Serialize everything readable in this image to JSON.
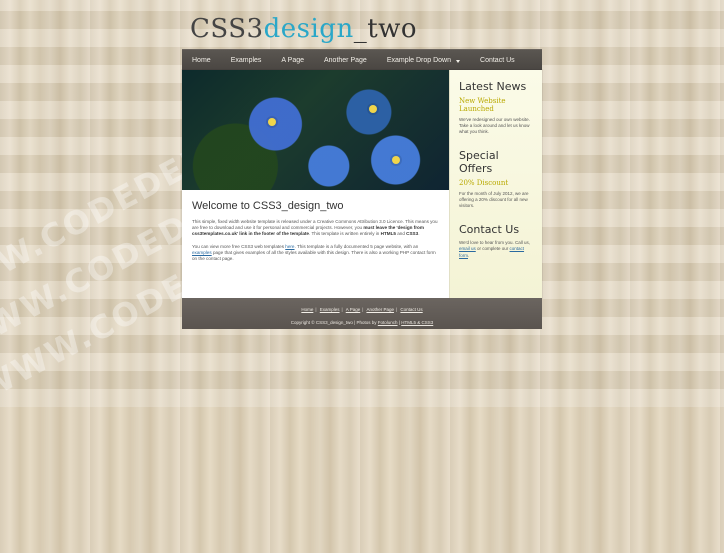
{
  "logo": {
    "text_a": "CSS3",
    "text_b": "design",
    "text_c": "_two"
  },
  "nav": {
    "items": [
      {
        "label": "Home"
      },
      {
        "label": "Examples"
      },
      {
        "label": "A Page"
      },
      {
        "label": "Another Page"
      },
      {
        "label": "Example Drop Down"
      },
      {
        "label": "Contact Us"
      }
    ]
  },
  "main": {
    "title": "Welcome to CSS3_design_two",
    "p1_a": "This simple, fixed width website template is released under a Creative Commons Attribution 3.0 Licence. This means you are free to download and use it for personal and commercial projects. However, you ",
    "p1_strong": "must leave the 'design from css3templates.co.uk' link in the footer of the template",
    "p1_b": ". This template is written entirely in ",
    "p1_html": "HTML5",
    "p1_c": " and ",
    "p1_css": "CSS3",
    "p1_d": ".",
    "p2_a": "You can view more free CSS3 web templates ",
    "p2_link1": "here",
    "p2_b": ". This template is a fully documented 5 page website, with an ",
    "p2_link2": "examples",
    "p2_c": " page that gives examples of all the styles available with this design. There is also a working PHP contact form on the contact page."
  },
  "sidebar": {
    "latest_title": "Latest News",
    "latest_sub": "New Website Launched",
    "latest_text": "We've redesigned our own website. Take a look around and let us know what you think.",
    "offers_title": "Special Offers",
    "offers_sub": "20% Discount",
    "offers_text": "For the month of July 2012, we are offering a 20% discount for all new visitors.",
    "contact_title": "Contact Us",
    "contact_text_a": "We'd love to hear from you. Call us, ",
    "contact_link1": "email us",
    "contact_text_b": " or complete our ",
    "contact_link2": "contact form",
    "contact_text_c": "."
  },
  "footer": {
    "links": [
      {
        "label": "Home"
      },
      {
        "label": "Examples"
      },
      {
        "label": "A Page"
      },
      {
        "label": "Another Page"
      },
      {
        "label": "Contact Us"
      }
    ],
    "copy_a": "Copyright © CSS3_design_two | Photos by ",
    "copy_link1": "Fotolunch",
    "copy_b": " | ",
    "copy_link2": "HTML5 & CSS3"
  }
}
